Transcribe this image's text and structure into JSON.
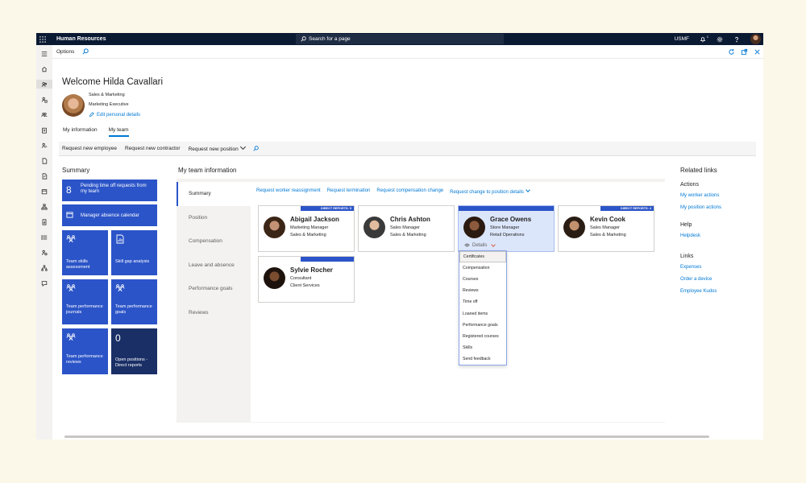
{
  "topbar": {
    "app_title": "Human Resources",
    "search_placeholder": "Search for a page",
    "company": "USMF",
    "notification_count": "1"
  },
  "optionsbar": {
    "label": "Options"
  },
  "header": {
    "welcome": "Welcome Hilda Cavallari",
    "department": "Sales & Marketing",
    "job_title": "Marketing Executive",
    "edit_link": "Edit personal details"
  },
  "tabs": [
    {
      "label": "My information",
      "active": false
    },
    {
      "label": "My team",
      "active": true
    }
  ],
  "actions": {
    "new_employee": "Request new employee",
    "new_contractor": "Request new contractor",
    "new_position": "Request new position"
  },
  "summary": {
    "heading": "Summary",
    "pending_count": "8",
    "pending_label": "Pending time off requests from my team",
    "absence_calendar": "Manager absence calendar",
    "skills_assessment": "Team skills assessment",
    "skill_gap": "Skill gap analysis",
    "perf_journals": "Team performance journals",
    "perf_goals": "Team performance goals",
    "perf_reviews": "Team performance reviews",
    "open_positions_count": "0",
    "open_positions": "Open positions - Direct reports"
  },
  "team": {
    "heading": "My team information",
    "vtabs": [
      "Summary",
      "Position",
      "Compensation",
      "Leave and absence",
      "Performance goals",
      "Reviews"
    ],
    "links": {
      "reassign": "Request worker reassignment",
      "termination": "Request termination",
      "compensation": "Request compensation change",
      "position": "Request change to position details"
    },
    "cards": [
      {
        "name": "Abigail Jackson",
        "role": "Marketing Manager",
        "dept": "Sales & Marketing",
        "badge": "DIRECT REPORTS: 5"
      },
      {
        "name": "Chris Ashton",
        "role": "Sales Manager",
        "dept": "Sales & Marketing",
        "badge": ""
      },
      {
        "name": "Grace Owens",
        "role": "Store Manager",
        "dept": "Retail Operations",
        "badge": ""
      },
      {
        "name": "Kevin Cook",
        "role": "Sales Manager",
        "dept": "Sales & Marketing",
        "badge": "DIRECT REPORTS: 4"
      },
      {
        "name": "Sylvie Rocher",
        "role": "Consultant",
        "dept": "Client Services",
        "badge": ""
      }
    ],
    "details_label": "Details",
    "details_menu": [
      "Certificates",
      "Compensation",
      "Courses",
      "Reviews",
      "Time off",
      "Loaned items",
      "Performance goals",
      "Registered courses",
      "Skills",
      "Send feedback"
    ]
  },
  "related": {
    "heading": "Related links",
    "actions_heading": "Actions",
    "worker_actions": "My worker actions",
    "position_actions": "My position actions",
    "help_heading": "Help",
    "helpdesk": "Helpdesk",
    "links_heading": "Links",
    "expenses": "Expenses",
    "order_device": "Order a device",
    "kudos": "Employee Kudos"
  },
  "colors": {
    "topbar": "#0b1a33",
    "tile": "#2b54c8",
    "tile_dark": "#1a2f66",
    "link": "#0078d4"
  }
}
